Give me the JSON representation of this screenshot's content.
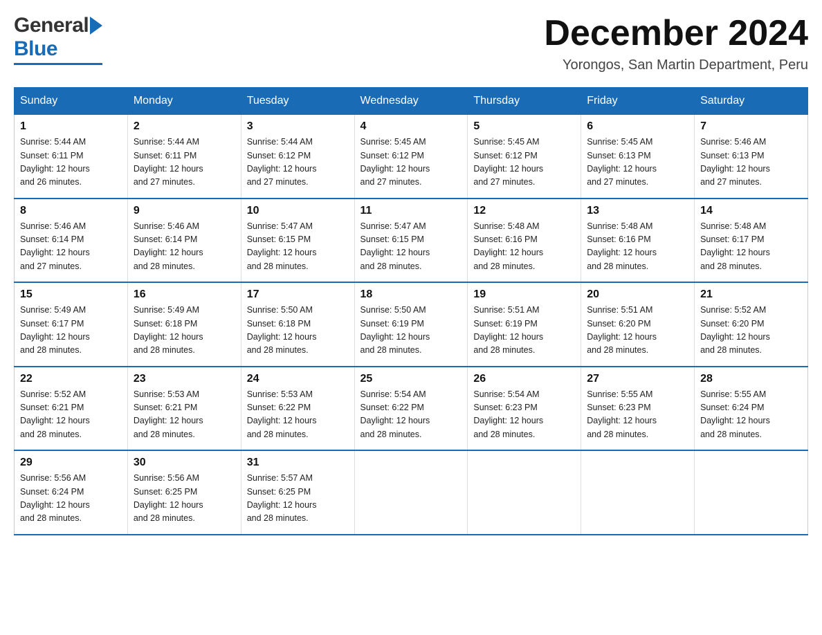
{
  "header": {
    "logo_general": "General",
    "logo_blue": "Blue",
    "month_title": "December 2024",
    "location": "Yorongos, San Martin Department, Peru"
  },
  "days_of_week": [
    "Sunday",
    "Monday",
    "Tuesday",
    "Wednesday",
    "Thursday",
    "Friday",
    "Saturday"
  ],
  "weeks": [
    [
      {
        "day": "1",
        "sunrise": "5:44 AM",
        "sunset": "6:11 PM",
        "daylight": "12 hours and 26 minutes."
      },
      {
        "day": "2",
        "sunrise": "5:44 AM",
        "sunset": "6:11 PM",
        "daylight": "12 hours and 27 minutes."
      },
      {
        "day": "3",
        "sunrise": "5:44 AM",
        "sunset": "6:12 PM",
        "daylight": "12 hours and 27 minutes."
      },
      {
        "day": "4",
        "sunrise": "5:45 AM",
        "sunset": "6:12 PM",
        "daylight": "12 hours and 27 minutes."
      },
      {
        "day": "5",
        "sunrise": "5:45 AM",
        "sunset": "6:12 PM",
        "daylight": "12 hours and 27 minutes."
      },
      {
        "day": "6",
        "sunrise": "5:45 AM",
        "sunset": "6:13 PM",
        "daylight": "12 hours and 27 minutes."
      },
      {
        "day": "7",
        "sunrise": "5:46 AM",
        "sunset": "6:13 PM",
        "daylight": "12 hours and 27 minutes."
      }
    ],
    [
      {
        "day": "8",
        "sunrise": "5:46 AM",
        "sunset": "6:14 PM",
        "daylight": "12 hours and 27 minutes."
      },
      {
        "day": "9",
        "sunrise": "5:46 AM",
        "sunset": "6:14 PM",
        "daylight": "12 hours and 28 minutes."
      },
      {
        "day": "10",
        "sunrise": "5:47 AM",
        "sunset": "6:15 PM",
        "daylight": "12 hours and 28 minutes."
      },
      {
        "day": "11",
        "sunrise": "5:47 AM",
        "sunset": "6:15 PM",
        "daylight": "12 hours and 28 minutes."
      },
      {
        "day": "12",
        "sunrise": "5:48 AM",
        "sunset": "6:16 PM",
        "daylight": "12 hours and 28 minutes."
      },
      {
        "day": "13",
        "sunrise": "5:48 AM",
        "sunset": "6:16 PM",
        "daylight": "12 hours and 28 minutes."
      },
      {
        "day": "14",
        "sunrise": "5:48 AM",
        "sunset": "6:17 PM",
        "daylight": "12 hours and 28 minutes."
      }
    ],
    [
      {
        "day": "15",
        "sunrise": "5:49 AM",
        "sunset": "6:17 PM",
        "daylight": "12 hours and 28 minutes."
      },
      {
        "day": "16",
        "sunrise": "5:49 AM",
        "sunset": "6:18 PM",
        "daylight": "12 hours and 28 minutes."
      },
      {
        "day": "17",
        "sunrise": "5:50 AM",
        "sunset": "6:18 PM",
        "daylight": "12 hours and 28 minutes."
      },
      {
        "day": "18",
        "sunrise": "5:50 AM",
        "sunset": "6:19 PM",
        "daylight": "12 hours and 28 minutes."
      },
      {
        "day": "19",
        "sunrise": "5:51 AM",
        "sunset": "6:19 PM",
        "daylight": "12 hours and 28 minutes."
      },
      {
        "day": "20",
        "sunrise": "5:51 AM",
        "sunset": "6:20 PM",
        "daylight": "12 hours and 28 minutes."
      },
      {
        "day": "21",
        "sunrise": "5:52 AM",
        "sunset": "6:20 PM",
        "daylight": "12 hours and 28 minutes."
      }
    ],
    [
      {
        "day": "22",
        "sunrise": "5:52 AM",
        "sunset": "6:21 PM",
        "daylight": "12 hours and 28 minutes."
      },
      {
        "day": "23",
        "sunrise": "5:53 AM",
        "sunset": "6:21 PM",
        "daylight": "12 hours and 28 minutes."
      },
      {
        "day": "24",
        "sunrise": "5:53 AM",
        "sunset": "6:22 PM",
        "daylight": "12 hours and 28 minutes."
      },
      {
        "day": "25",
        "sunrise": "5:54 AM",
        "sunset": "6:22 PM",
        "daylight": "12 hours and 28 minutes."
      },
      {
        "day": "26",
        "sunrise": "5:54 AM",
        "sunset": "6:23 PM",
        "daylight": "12 hours and 28 minutes."
      },
      {
        "day": "27",
        "sunrise": "5:55 AM",
        "sunset": "6:23 PM",
        "daylight": "12 hours and 28 minutes."
      },
      {
        "day": "28",
        "sunrise": "5:55 AM",
        "sunset": "6:24 PM",
        "daylight": "12 hours and 28 minutes."
      }
    ],
    [
      {
        "day": "29",
        "sunrise": "5:56 AM",
        "sunset": "6:24 PM",
        "daylight": "12 hours and 28 minutes."
      },
      {
        "day": "30",
        "sunrise": "5:56 AM",
        "sunset": "6:25 PM",
        "daylight": "12 hours and 28 minutes."
      },
      {
        "day": "31",
        "sunrise": "5:57 AM",
        "sunset": "6:25 PM",
        "daylight": "12 hours and 28 minutes."
      },
      null,
      null,
      null,
      null
    ]
  ],
  "labels": {
    "sunrise": "Sunrise:",
    "sunset": "Sunset:",
    "daylight": "Daylight:"
  }
}
